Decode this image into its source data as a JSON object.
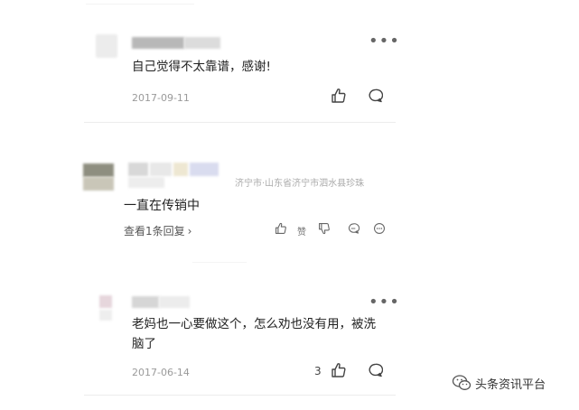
{
  "comments": [
    {
      "text": "自己觉得不太靠谱，感谢!",
      "date": "2017-09-11",
      "like_count": ""
    },
    {
      "location": "济宁市·山东省济宁市泗水县珍珠",
      "text": "一直在传销中",
      "reply_link": "查看1条回复",
      "reply_chevron": "›",
      "like_label": "赞"
    },
    {
      "text_line1": "老妈也一心要做这个，怎么劝也没有用，被洗",
      "text_line2": "脑了",
      "date": "2017-06-14",
      "like_count": "3"
    }
  ],
  "watermark": {
    "text": "头条资讯平台",
    "icon": "wechat-icon"
  },
  "icons": {
    "more": "more-icon",
    "like": "thumbs-up-icon",
    "comment": "comment-bubble-icon",
    "dislike": "thumbs-down-icon"
  },
  "colors": {
    "text": "#222222",
    "meta": "#9a9a9a",
    "divider": "#ececec"
  }
}
